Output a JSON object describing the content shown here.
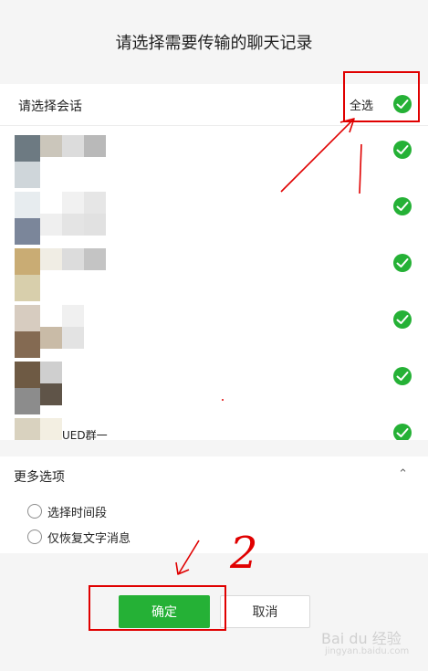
{
  "dialog": {
    "title": "请选择需要传输的聊天记录"
  },
  "session_select": {
    "label": "请选择会话",
    "select_all_label": "全选"
  },
  "conversations": [
    {
      "name": ""
    },
    {
      "name": ""
    },
    {
      "name": ""
    },
    {
      "name": ""
    },
    {
      "name": ""
    },
    {
      "name": "UED群一"
    }
  ],
  "more_options": {
    "title": "更多选项",
    "options": [
      {
        "label": "选择时间段"
      },
      {
        "label": "仅恢复文字消息"
      }
    ]
  },
  "buttons": {
    "confirm_label": "确定",
    "cancel_label": "取消"
  },
  "annotations": {
    "step_number": "2"
  },
  "watermark": {
    "brand": "Bai du 经验",
    "url": "jingyan.baidu.com"
  },
  "colors": {
    "accent_green": "#25b136",
    "annotation_red": "#e00000",
    "background": "#f5f5f5"
  }
}
